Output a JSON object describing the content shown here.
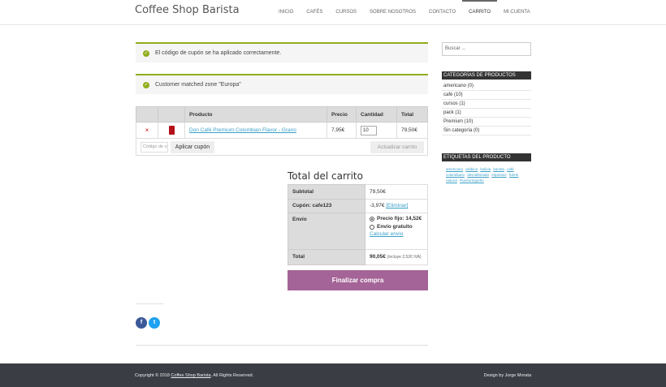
{
  "site": {
    "title": "Coffee Shop Barista"
  },
  "nav": {
    "items": [
      {
        "label": "INICIO",
        "active": false
      },
      {
        "label": "CAFÉS",
        "active": false
      },
      {
        "label": "CURSOS",
        "active": false
      },
      {
        "label": "SOBRE NOSOTROS",
        "active": false
      },
      {
        "label": "CONTACTO",
        "active": false
      },
      {
        "label": "CARRITO",
        "active": true
      },
      {
        "label": "MI CUENTA",
        "active": false
      }
    ]
  },
  "notices": [
    "El código de cupón se ha aplicado correctamente.",
    "Customer matched zone \"Europa\""
  ],
  "cart": {
    "headers": {
      "product": "Producto",
      "price": "Precio",
      "quantity": "Cantidad",
      "total": "Total"
    },
    "items": [
      {
        "remove": "×",
        "product": "Don Café Premium Colombian Flavor - Grano",
        "price": "7,95€",
        "quantity": "10",
        "total": "79,50€"
      }
    ],
    "coupon_placeholder": "Código de cupón",
    "apply_coupon_label": "Aplicar cupón",
    "update_cart_label": "Actualizar carrito"
  },
  "totals": {
    "title": "Total del carrito",
    "subtotal_label": "Subtotal",
    "subtotal_value": "79,50€",
    "coupon_label": "Cupón: cafe123",
    "coupon_value": "-3,97€",
    "coupon_remove": "[Eliminar]",
    "shipping_label": "Envío",
    "shipping_option_1": "Precio fijo: 14,52€",
    "shipping_option_2": "Envío gratuito",
    "calc_shipping": "Calcular envío",
    "total_label": "Total",
    "total_value": "90,05€",
    "tax_note": "(incluye 2,52€ IVA)",
    "checkout_label": "Finalizar compra"
  },
  "share": {
    "facebook": "f",
    "twitter": "t"
  },
  "sidebar": {
    "search_placeholder": "Buscar ...",
    "categories_title": "CATEGORÍAS DE PRODUCTOS",
    "categories": [
      "americano  (0)",
      "café  (10)",
      "cursos  (1)",
      "pack  (1)",
      "Premium  (10)",
      "Sin categoría  (0)"
    ],
    "tags_title": "ETIQUETAS DEL PRODUCTO",
    "tags": [
      "americano",
      "arábica",
      "bolivia",
      "barista",
      "café",
      "colombiano",
      "descafeinado",
      "espresso",
      "fuerte",
      "natural",
      "Puertorriqueño"
    ]
  },
  "footer": {
    "copyright_prefix": "Copyright © 2018",
    "copyright_link": "Coffee Shop Barista",
    "copyright_suffix": ". All Rights Reserved.",
    "design": "Design by Jorge Morata"
  }
}
